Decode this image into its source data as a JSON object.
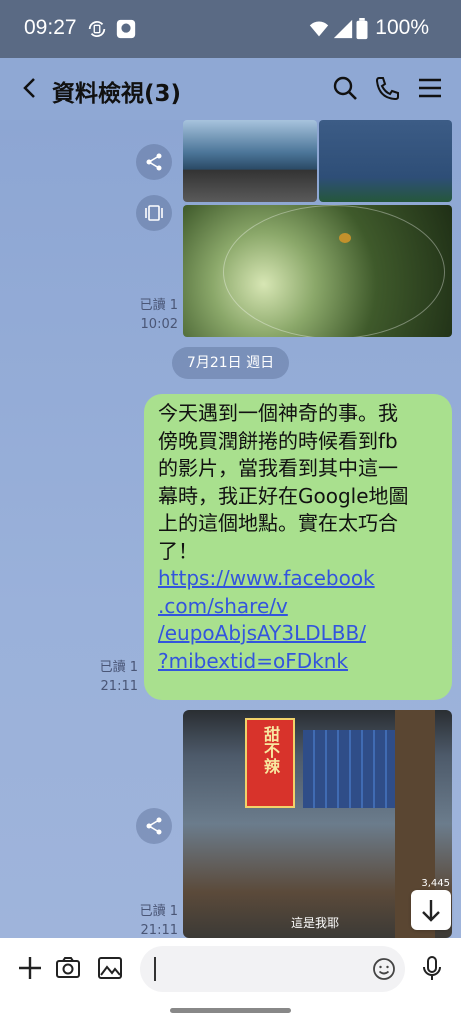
{
  "status_bar": {
    "time": "09:27",
    "battery_text": "100%"
  },
  "header": {
    "title": "資料檢視(3)",
    "back_icon": "chevron-left-icon",
    "search_icon": "search-icon",
    "call_icon": "phone-icon",
    "menu_icon": "hamburger-menu-icon"
  },
  "messages": [
    {
      "type": "photo_group",
      "read_label": "已讀 1",
      "time": "10:02"
    },
    {
      "type": "date_separator",
      "label": "7月21日 週日"
    },
    {
      "type": "text",
      "read_label": "已讀 1",
      "time": "21:11",
      "text_lines": [
        "今天遇到一個神奇的事。我",
        "傍晚買潤餅捲的時候看到fb",
        "的影片，當我看到其中這一",
        "幕時，我正好在Google地圖",
        "上的這個地點。實在太巧合",
        "了！"
      ],
      "link_lines": [
        "https://www.facebook",
        ".com/share/v",
        "/eupoAbjsAY3LDLBB/",
        "?mibextid=oFDknk"
      ]
    },
    {
      "type": "video",
      "read_label": "已讀 1",
      "time": "21:11",
      "caption": "這是我耶",
      "sign_text": "甜不辣",
      "view_count": "3,445"
    }
  ],
  "input_bar": {
    "placeholder": "",
    "plus_icon": "plus-icon",
    "camera_icon": "camera-icon",
    "image_icon": "image-icon",
    "emoji_icon": "emoji-icon",
    "mic_icon": "microphone-icon"
  }
}
